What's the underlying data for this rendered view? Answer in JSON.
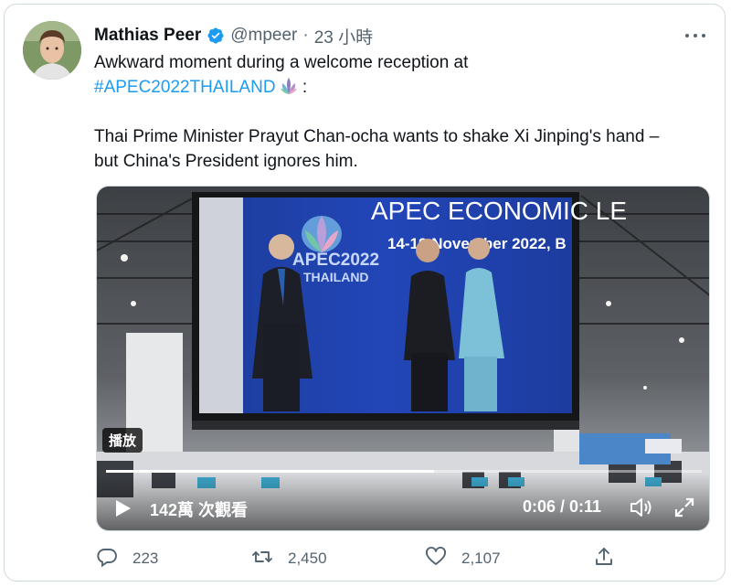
{
  "tweet": {
    "author_name": "Mathias Peer",
    "handle": "@mpeer",
    "separator": "·",
    "time": "23 小時",
    "line1": "Awkward moment during a welcome reception at",
    "hashtag": "#APEC2022THAILAND",
    "after_hashtag": " :",
    "line3": "Thai Prime Minister Prayut Chan-ocha wants to shake Xi Jinping's hand –",
    "line4": "but China's President ignores him."
  },
  "video": {
    "screen_title": "APEC ECONOMIC LE",
    "screen_date": "14-19 November 2022, B",
    "logo_text_1": "APEC2022",
    "logo_text_2": "THAILAND",
    "play_label": "播放",
    "views": "142萬 次觀看",
    "timecode": "0:06 / 0:11",
    "progress": 0.55
  },
  "actions": {
    "reply_count": "223",
    "retweet_count": "2,450",
    "like_count": "2,107"
  },
  "icons": {
    "verified": "verified-badge-icon",
    "more": "more-icon",
    "reply": "reply-icon",
    "retweet": "retweet-icon",
    "like": "heart-icon",
    "share": "share-icon",
    "play": "play-icon",
    "volume": "volume-icon",
    "fullscreen": "fullscreen-icon"
  },
  "colors": {
    "accent": "#1d9bf0",
    "text": "#0f1419",
    "muted": "#536471"
  }
}
